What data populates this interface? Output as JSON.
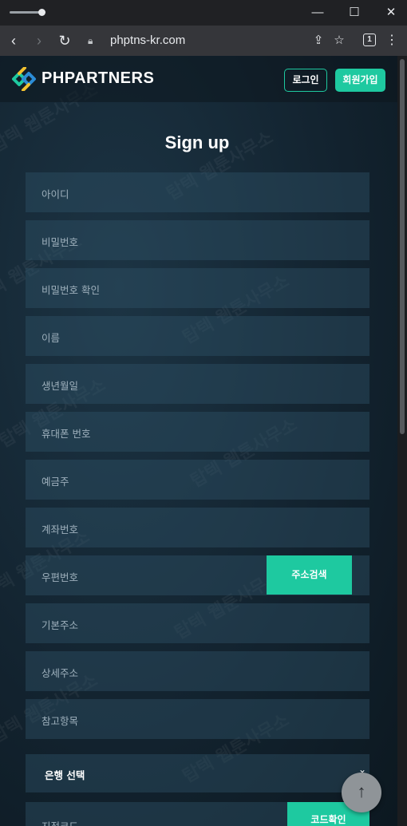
{
  "browser": {
    "url": "phptns-kr.com",
    "tab_count": "1"
  },
  "site": {
    "logo_text": "PHPARTNERS",
    "login_label": "로그인",
    "join_label": "회원가입",
    "brand_color": "#1ec9a0"
  },
  "watermark_text": "탑텍 웹툰사무소",
  "form": {
    "title": "Sign up",
    "fields": [
      {
        "placeholder": "아이디"
      },
      {
        "placeholder": "비밀번호"
      },
      {
        "placeholder": "비밀번호 확인"
      },
      {
        "placeholder": "이름"
      },
      {
        "placeholder": "생년월일"
      },
      {
        "placeholder": "휴대폰 번호"
      },
      {
        "placeholder": "예금주"
      },
      {
        "placeholder": "계좌번호"
      },
      {
        "placeholder": "우편번호"
      },
      {
        "placeholder": "기본주소"
      },
      {
        "placeholder": "상세주소"
      },
      {
        "placeholder": "참고항목"
      },
      {
        "placeholder": "지점코드"
      }
    ],
    "address_search_label": "주소검색",
    "bank_select_label": "은행 선택",
    "code_check_label": "코드확인"
  }
}
